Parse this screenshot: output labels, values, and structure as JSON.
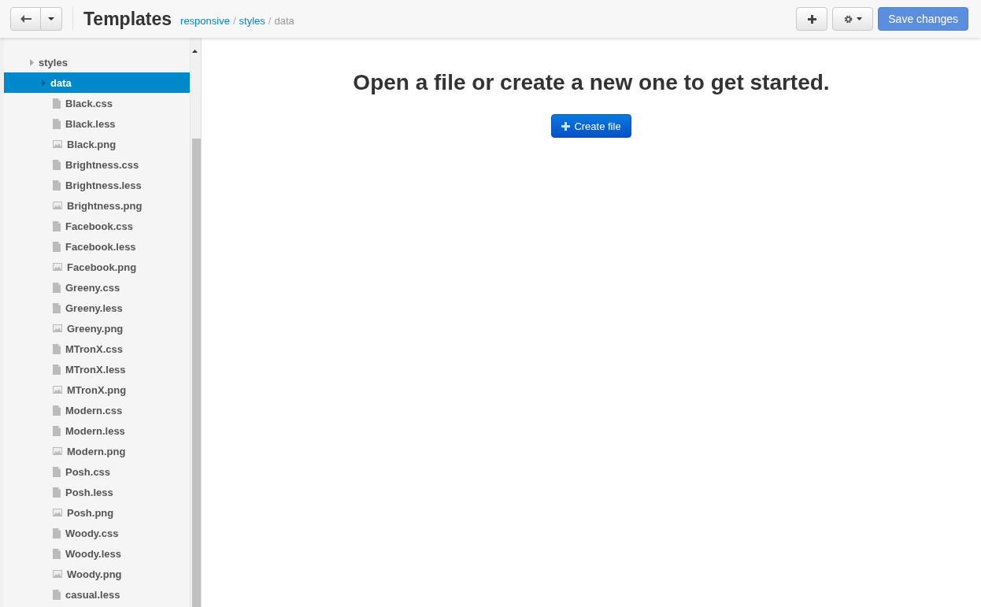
{
  "header": {
    "title": "Templates",
    "breadcrumb": [
      {
        "label": "responsive",
        "link": true
      },
      {
        "label": "styles",
        "link": true
      },
      {
        "label": "data",
        "link": false
      }
    ],
    "separator": "/",
    "save_button": "Save changes"
  },
  "tree": [
    {
      "name": "styles",
      "kind": "folder",
      "selected": false,
      "children": [
        {
          "name": "data",
          "kind": "folder",
          "selected": true,
          "children": [
            {
              "name": "Black.css",
              "kind": "file",
              "selected": false
            },
            {
              "name": "Black.less",
              "kind": "file",
              "selected": false
            },
            {
              "name": "Black.png",
              "kind": "image",
              "selected": false
            },
            {
              "name": "Brightness.css",
              "kind": "file",
              "selected": false
            },
            {
              "name": "Brightness.less",
              "kind": "file",
              "selected": false
            },
            {
              "name": "Brightness.png",
              "kind": "image",
              "selected": false
            },
            {
              "name": "Facebook.css",
              "kind": "file",
              "selected": false
            },
            {
              "name": "Facebook.less",
              "kind": "file",
              "selected": false
            },
            {
              "name": "Facebook.png",
              "kind": "image",
              "selected": false
            },
            {
              "name": "Greeny.css",
              "kind": "file",
              "selected": false
            },
            {
              "name": "Greeny.less",
              "kind": "file",
              "selected": false
            },
            {
              "name": "Greeny.png",
              "kind": "image",
              "selected": false
            },
            {
              "name": "MTronX.css",
              "kind": "file",
              "selected": false
            },
            {
              "name": "MTronX.less",
              "kind": "file",
              "selected": false
            },
            {
              "name": "MTronX.png",
              "kind": "image",
              "selected": false
            },
            {
              "name": "Modern.css",
              "kind": "file",
              "selected": false
            },
            {
              "name": "Modern.less",
              "kind": "file",
              "selected": false
            },
            {
              "name": "Modern.png",
              "kind": "image",
              "selected": false
            },
            {
              "name": "Posh.css",
              "kind": "file",
              "selected": false
            },
            {
              "name": "Posh.less",
              "kind": "file",
              "selected": false
            },
            {
              "name": "Posh.png",
              "kind": "image",
              "selected": false
            },
            {
              "name": "Woody.css",
              "kind": "file",
              "selected": false
            },
            {
              "name": "Woody.less",
              "kind": "file",
              "selected": false
            },
            {
              "name": "Woody.png",
              "kind": "image",
              "selected": false
            },
            {
              "name": "casual.less",
              "kind": "file",
              "selected": false
            }
          ]
        }
      ]
    }
  ],
  "empty_state": {
    "heading": "Open a file or create a new one to get started.",
    "button": "Create file"
  }
}
